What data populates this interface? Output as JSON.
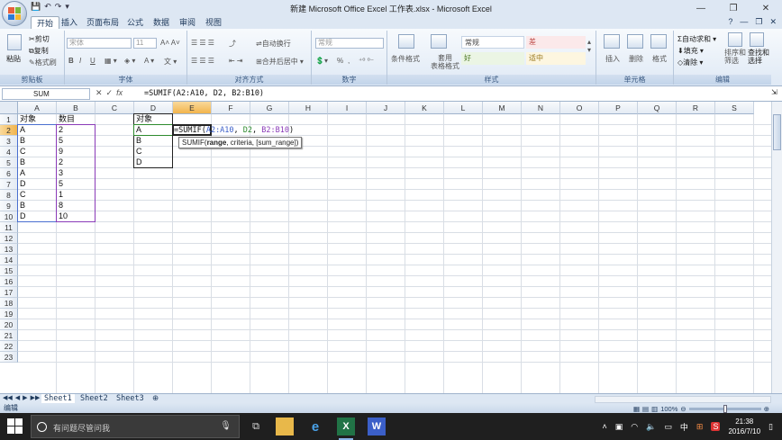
{
  "window": {
    "title": "新建 Microsoft Office Excel 工作表.xlsx - Microsoft Excel",
    "minimize_icon": "minimize-icon",
    "restore_icon": "restore-icon",
    "close_icon": "close-icon"
  },
  "qat": {
    "save": "💾",
    "undo": "↶",
    "redo": "↷",
    "more": "▾"
  },
  "tabs": [
    {
      "label": "开始",
      "active": true
    },
    {
      "label": "插入"
    },
    {
      "label": "页面布局"
    },
    {
      "label": "公式"
    },
    {
      "label": "数据"
    },
    {
      "label": "审阅"
    },
    {
      "label": "视图"
    }
  ],
  "ribbon": {
    "clipboard": {
      "label": "剪贴板",
      "paste": "粘贴",
      "cut": "剪切",
      "copy": "复制",
      "format_painter": "格式刷"
    },
    "font": {
      "label": "字体",
      "font_name": "宋体",
      "font_size": "11",
      "bold": "B",
      "italic": "I",
      "underline": "U"
    },
    "alignment": {
      "label": "对齐方式",
      "wrap": "自动换行",
      "merge": "合并后居中"
    },
    "number": {
      "label": "数字",
      "format": "常规",
      "percent": "%",
      "comma": ","
    },
    "styles": {
      "label": "样式",
      "conditional": "条件格式",
      "table_format": "套用\n表格格式",
      "normal": "常规",
      "bad": "差",
      "good": "好",
      "neutral": "适中"
    },
    "cells": {
      "label": "单元格",
      "insert": "插入",
      "delete": "删除",
      "format": "格式"
    },
    "editing": {
      "label": "编辑",
      "autosum": "自动求和",
      "fill": "填充",
      "clear": "清除",
      "sort_filter": "排序和\n筛选",
      "find_select": "查找和\n选择"
    }
  },
  "formula_bar": {
    "name_box": "SUM",
    "cancel": "✕",
    "enter": "✓",
    "fx": "fx",
    "content": "=SUMIF(A2:A10, D2, B2:B10)"
  },
  "columns": [
    "A",
    "B",
    "C",
    "D",
    "E",
    "F",
    "G",
    "H",
    "I",
    "J",
    "K",
    "L",
    "M",
    "N",
    "O",
    "P",
    "Q",
    "R",
    "S"
  ],
  "rows": [
    "1",
    "2",
    "3",
    "4",
    "5",
    "6",
    "7",
    "8",
    "9",
    "10",
    "11",
    "12",
    "13",
    "14",
    "15",
    "16",
    "17",
    "18",
    "19",
    "20",
    "21",
    "22",
    "23"
  ],
  "cells": {
    "A1": "对象",
    "B1": "数目",
    "D1": "对象",
    "A2": "A",
    "B2": "2",
    "D2": "A",
    "A3": "B",
    "B3": "5",
    "D3": "B",
    "A4": "C",
    "B4": "9",
    "D4": "C",
    "A5": "B",
    "B5": "2",
    "D5": "D",
    "A6": "A",
    "B6": "3",
    "A7": "D",
    "B7": "5",
    "A8": "C",
    "B8": "1",
    "A9": "B",
    "B9": "8",
    "A10": "D",
    "B10": "10"
  },
  "editing_cell": {
    "prefix": "=SUMIF(",
    "arg1": "A2:A10",
    "sep1": ", ",
    "arg2": "D2",
    "sep2": ", ",
    "arg3": "B2:B10",
    "suffix": ")"
  },
  "tooltip": {
    "fn": "SUMIF(",
    "arg1": "range",
    "rest": ", criteria, [sum_range])"
  },
  "colors": {
    "arg1": "#3b5fc8",
    "arg2": "#2e8b2e",
    "arg3": "#8a3ab8"
  },
  "sheets": [
    {
      "label": "Sheet1",
      "active": true
    },
    {
      "label": "Sheet2"
    },
    {
      "label": "Sheet3"
    }
  ],
  "status": {
    "mode": "编辑",
    "zoom": "100%"
  },
  "taskbar": {
    "search_placeholder": "有问题尽管问我",
    "time": "21:38",
    "date": "2016/7/10",
    "ime": "中"
  }
}
